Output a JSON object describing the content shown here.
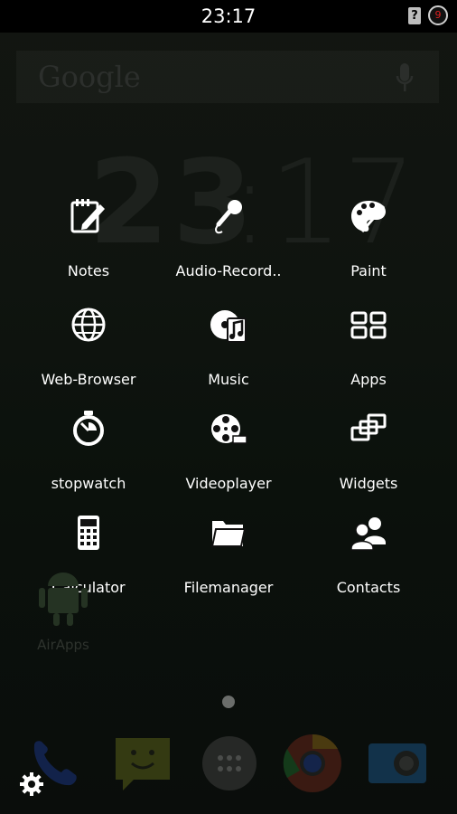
{
  "status_bar": {
    "time": "23:17",
    "sim_icon": "sim-unknown-icon",
    "badge_count": "9"
  },
  "home_widgets": {
    "search_label": "Google",
    "mic_icon": "mic-icon",
    "clock_hours": "23",
    "clock_minutes": "17"
  },
  "app_grid": [
    {
      "label": "Notes",
      "icon": "notes-icon"
    },
    {
      "label": "Audio-Record..",
      "icon": "microphone-icon"
    },
    {
      "label": "Paint",
      "icon": "palette-icon"
    },
    {
      "label": "Web-Browser",
      "icon": "globe-icon"
    },
    {
      "label": "Music",
      "icon": "music-icon"
    },
    {
      "label": "Apps",
      "icon": "apps-grid-icon"
    },
    {
      "label": "stopwatch",
      "icon": "stopwatch-icon"
    },
    {
      "label": "Videoplayer",
      "icon": "film-reel-icon"
    },
    {
      "label": "Widgets",
      "icon": "widgets-icon"
    },
    {
      "label": "Calculator",
      "icon": "calculator-icon"
    },
    {
      "label": "Filemanager",
      "icon": "folder-icon"
    },
    {
      "label": "Contacts",
      "icon": "contacts-icon"
    }
  ],
  "desktop": {
    "shortcut_label": "AirApps",
    "shortcut_icon": "android-icon"
  },
  "dock": [
    "phone-icon",
    "messaging-icon",
    "app-drawer-icon",
    "chrome-icon",
    "camera-icon"
  ],
  "settings_icon": "gear-icon",
  "colors": {
    "background": "#0f140f",
    "overlay_text": "#ffffff",
    "badge_text": "#e02020"
  }
}
